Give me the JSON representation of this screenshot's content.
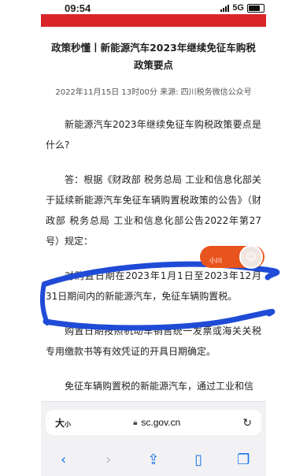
{
  "status_bar": {
    "time": "09:54",
    "network": "5G"
  },
  "article": {
    "title": "政策秒懂丨新能源汽车2023年继续免征车购税政策要点",
    "meta": "2022年11月15日 13时00分 来源: 四川税务微信公众号",
    "paragraphs": [
      "新能源汽车2023年继续免征车购税政策要点是什么?",
      "答：根据《财政部 税务总局 工业和信息化部关于延续新能源汽车免征车辆购置税政策的公告》（财政部 税务总局 工业和信息化部公告2022年第27号）规定：",
      "对购置日期在2023年1月1日至2023年12月31日期间内的新能源汽车，免征车辆购置税。",
      "购置日期按照机动车销售统一发票或海关关税专用缴款书等有效凭证的开具日期确定。",
      "免征车辆购置税的新能源汽车，通过工业和信"
    ]
  },
  "floating_badge": {
    "text": "小川"
  },
  "browser": {
    "text_size_label": "大",
    "text_size_small": "小",
    "url": "sc.gov.cn"
  },
  "icons": {
    "back": "chevron-left-icon",
    "forward": "chevron-right-icon",
    "share": "share-icon",
    "bookmarks": "book-icon",
    "tabs": "tabs-icon"
  },
  "colors": {
    "banner": "#d9252a",
    "highlight": "#1f4bd6",
    "badge": "#e8541e",
    "accent": "#1a73e8"
  }
}
